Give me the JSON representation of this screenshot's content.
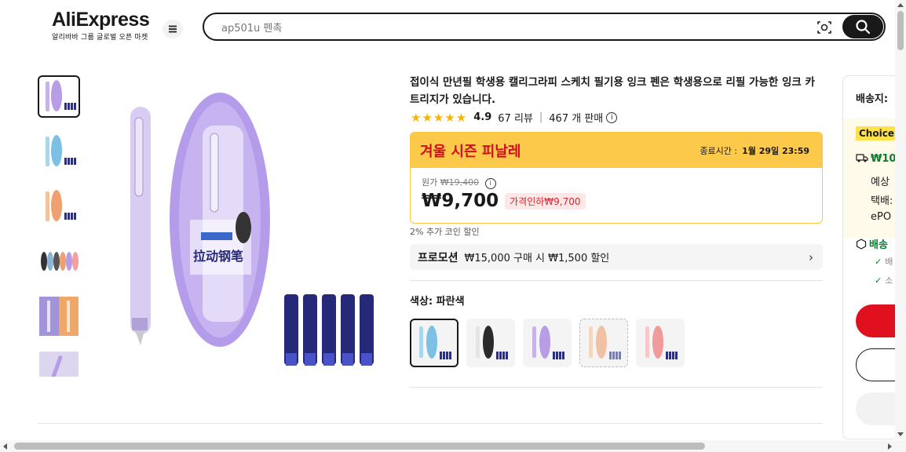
{
  "header": {
    "logo": "AliExpress",
    "logo_sub": "알리바바 그룹 글로벌 오픈 마켓",
    "search_placeholder": "ap501u 펜촉"
  },
  "product": {
    "title": "접이식 만년필 학생용 캘리그라피 스케치 필기용 잉크 펜은 학생용으로 리필 가능한 잉크 카트리지가 있습니다.",
    "rating": "4.9",
    "reviews": "67 리뷰",
    "sold": "467 개 판매",
    "stars": "★★★★★"
  },
  "sale": {
    "name": "겨울 시즌 피날레",
    "end_label": "종료시간 :",
    "end_time": "1월 29일 23:59",
    "original_label": "원가",
    "original_price": "₩19,400",
    "price": "₩9,700",
    "discount": "가격인하₩9,700"
  },
  "coin_text": "2% 추가 코인 할인",
  "promotion": {
    "label": "프로모션",
    "text": "₩15,000 구매 시 ₩1,500 할인"
  },
  "color": {
    "label": "색상: 파란색",
    "options": [
      "blue",
      "black",
      "purple",
      "orange",
      "pink"
    ]
  },
  "shipping": {
    "ship_to": "배송지:",
    "choice": "Choice",
    "price": "₩10,",
    "line1": "예상",
    "line2": "택배:",
    "line3": "ePO",
    "safe": "배송",
    "check1": "배",
    "check2": "소"
  },
  "colors": {
    "accent_red": "#e0101f",
    "sale_yellow": "#fcc94a",
    "sale_red": "#cd0f1d"
  }
}
